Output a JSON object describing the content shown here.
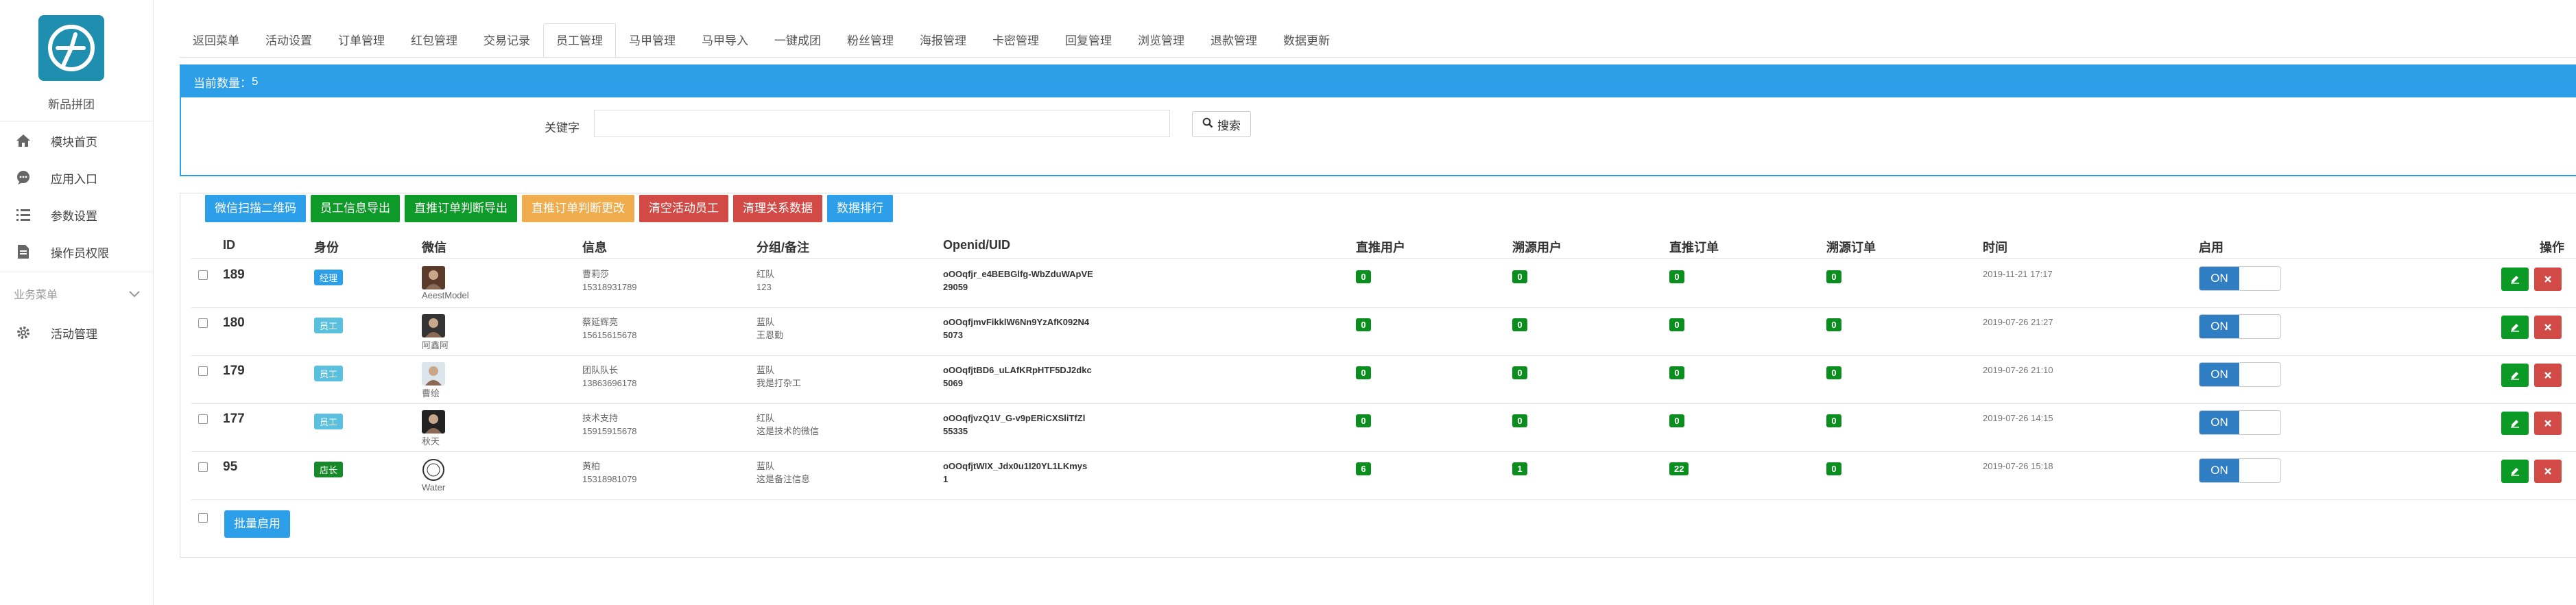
{
  "sidebar": {
    "brand": "新品拼团",
    "items": [
      {
        "label": "模块首页",
        "icon": "home-icon"
      },
      {
        "label": "应用入口",
        "icon": "chat-icon"
      },
      {
        "label": "参数设置",
        "icon": "list-icon"
      },
      {
        "label": "操作员权限",
        "icon": "document-icon"
      }
    ],
    "group_label": "业务菜单",
    "group_items": [
      {
        "label": "活动管理",
        "icon": "gear-icon"
      }
    ]
  },
  "tabs": [
    "返回菜单",
    "活动设置",
    "订单管理",
    "红包管理",
    "交易记录",
    "员工管理",
    "马甲管理",
    "马甲导入",
    "一键成团",
    "粉丝管理",
    "海报管理",
    "卡密管理",
    "回复管理",
    "浏览管理",
    "退款管理",
    "数据更新"
  ],
  "active_tab": "员工管理",
  "filter": {
    "count_label": "当前数量：",
    "count": "5",
    "keyword_label": "关键字",
    "keyword_value": "",
    "search_label": "搜索"
  },
  "toolbar": [
    {
      "label": "微信扫描二维码",
      "color": "#2d9ee8"
    },
    {
      "label": "员工信息导出",
      "color": "#0e9a28"
    },
    {
      "label": "直推订单判断导出",
      "color": "#0e9a28"
    },
    {
      "label": "直推订单判断更改",
      "color": "#f0ad4e"
    },
    {
      "label": "清空活动员工",
      "color": "#d24a46"
    },
    {
      "label": "清理关系数据",
      "color": "#d24a46"
    },
    {
      "label": "数据排行",
      "color": "#2d9ee8"
    }
  ],
  "columns": [
    "ID",
    "身份",
    "微信",
    "信息",
    "分组/备注",
    "Openid/UID",
    "直推用户",
    "溯源用户",
    "直推订单",
    "溯源订单",
    "时间",
    "启用",
    "操作"
  ],
  "rows": [
    {
      "id": "189",
      "role": "经理",
      "role_color": "#2d9ee8",
      "wx": "AeestModel",
      "info1": "曹莉莎",
      "info2": "15318931789",
      "group": "红队",
      "note": "123",
      "openid1": "oOOqfjr_e4BEBGlfg-WbZduWApVE",
      "openid2": "29059",
      "direct_users": "0",
      "source_users": "0",
      "direct_orders": "0",
      "source_orders": "0",
      "time": "2019-11-21 17:17",
      "enabled": "ON"
    },
    {
      "id": "180",
      "role": "员工",
      "role_color": "#5bc0de",
      "wx": "阿鑫阿",
      "info1": "蔡延辉亮",
      "info2": "15615615678",
      "group": "蓝队",
      "note": "王恩勤",
      "openid1": "oOOqfjmvFikklW6Nn9YzAfK092N4",
      "openid2": "5073",
      "direct_users": "0",
      "source_users": "0",
      "direct_orders": "0",
      "source_orders": "0",
      "time": "2019-07-26 21:27",
      "enabled": "ON"
    },
    {
      "id": "179",
      "role": "员工",
      "role_color": "#5bc0de",
      "wx": "曹绘",
      "info1": "团队队长",
      "info2": "13863696178",
      "group": "蓝队",
      "note": "我是打杂工",
      "openid1": "oOOqfjtBD6_uLAfKRpHTF5DJ2dkc",
      "openid2": "5069",
      "direct_users": "0",
      "source_users": "0",
      "direct_orders": "0",
      "source_orders": "0",
      "time": "2019-07-26 21:10",
      "enabled": "ON"
    },
    {
      "id": "177",
      "role": "员工",
      "role_color": "#5bc0de",
      "wx": "秋天",
      "info1": "技术支持",
      "info2": "15915915678",
      "group": "红队",
      "note": "这是技术的微信",
      "openid1": "oOOqfjvzQ1V_G-v9pERiCXSliTfZl",
      "openid2": "55335",
      "direct_users": "0",
      "source_users": "0",
      "direct_orders": "0",
      "source_orders": "0",
      "time": "2019-07-26 14:15",
      "enabled": "ON"
    },
    {
      "id": "95",
      "role": "店长",
      "role_color": "#168a2b",
      "wx": "Water",
      "info1": "黄柏",
      "info2": "15318981079",
      "group": "蓝队",
      "note": "这是备注信息",
      "openid1": "oOOqfjtWIX_Jdx0u1I20YL1LKmys",
      "openid2": "1",
      "direct_users": "6",
      "source_users": "1",
      "direct_orders": "22",
      "source_orders": "0",
      "time": "2019-07-26 15:18",
      "enabled": "ON"
    }
  ],
  "batch_label": "批量启用"
}
